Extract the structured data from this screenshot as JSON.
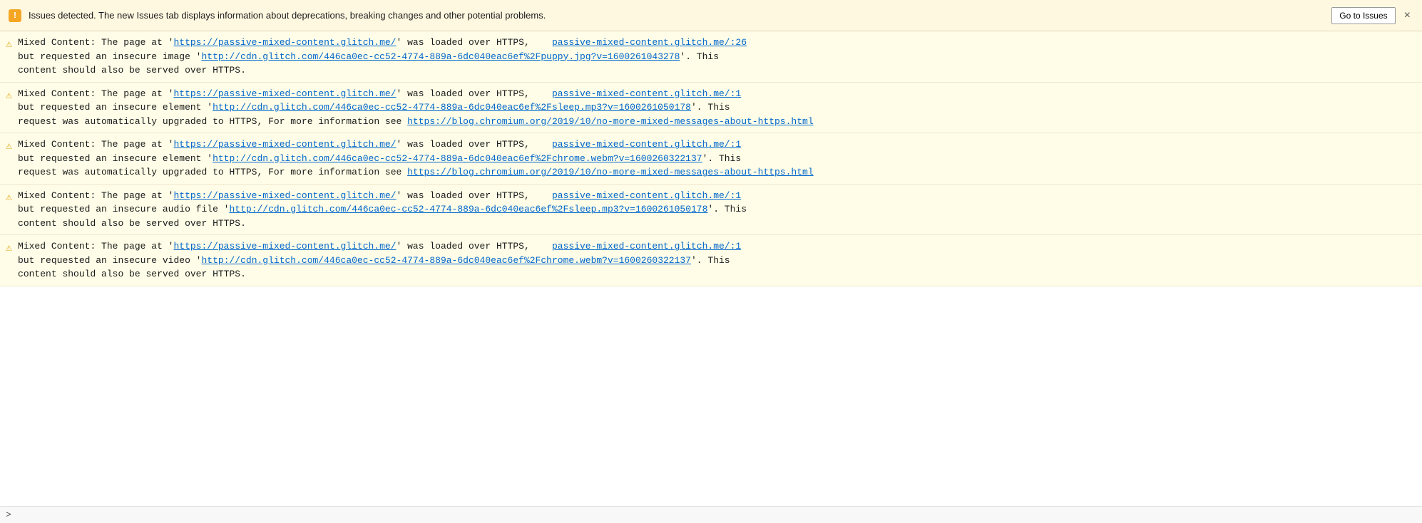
{
  "banner": {
    "icon": "!",
    "text": "Issues detected. The new Issues tab displays information about deprecations, breaking changes and other potential problems.",
    "go_to_issues_label": "Go to Issues",
    "close_label": "×"
  },
  "messages": [
    {
      "id": 1,
      "lines": [
        {
          "type": "mixed",
          "parts": [
            {
              "text": "Mixed Content: The page at '",
              "link": false
            },
            {
              "text": "https://passive-mixed-content.glitch.me/",
              "link": true,
              "href": "https://passive-mixed-content.glitch.me/"
            },
            {
              "text": "' was loaded over HTTPS,    ",
              "link": false
            },
            {
              "text": "passive-mixed-content.glitch.me/:26",
              "link": true,
              "href": "#"
            },
            {
              "text": "\nbut requested an insecure image '",
              "link": false
            },
            {
              "text": "http://cdn.glitch.com/446ca0ec-cc52-4774-889a-6dc040eac6ef%2Fpuppy.jpg?v=1600261043278",
              "link": true,
              "href": "#"
            },
            {
              "text": "'. This\ncontent should also be served over HTTPS.",
              "link": false
            }
          ]
        }
      ]
    },
    {
      "id": 2,
      "lines": [
        {
          "type": "mixed",
          "parts": [
            {
              "text": "Mixed Content: The page at '",
              "link": false
            },
            {
              "text": "https://passive-mixed-content.glitch.me/",
              "link": true,
              "href": "https://passive-mixed-content.glitch.me/"
            },
            {
              "text": "' was loaded over HTTPS,    ",
              "link": false
            },
            {
              "text": "passive-mixed-content.glitch.me/:1",
              "link": true,
              "href": "#"
            },
            {
              "text": "\nbut requested an insecure element '",
              "link": false
            },
            {
              "text": "http://cdn.glitch.com/446ca0ec-cc52-4774-889a-6dc040eac6ef%2Fsleep.mp3?v=1600261050178",
              "link": true,
              "href": "#"
            },
            {
              "text": "'. This\nrequest was automatically upgraded to HTTPS, For more information see ",
              "link": false
            },
            {
              "text": "https://blog.chromium.org/2019/10/no-more-mixed-messages-about-https.html",
              "link": true,
              "href": "#"
            }
          ]
        }
      ]
    },
    {
      "id": 3,
      "lines": [
        {
          "type": "mixed",
          "parts": [
            {
              "text": "Mixed Content: The page at '",
              "link": false
            },
            {
              "text": "https://passive-mixed-content.glitch.me/",
              "link": true,
              "href": "https://passive-mixed-content.glitch.me/"
            },
            {
              "text": "' was loaded over HTTPS,    ",
              "link": false
            },
            {
              "text": "passive-mixed-content.glitch.me/:1",
              "link": true,
              "href": "#"
            },
            {
              "text": "\nbut requested an insecure element '",
              "link": false
            },
            {
              "text": "http://cdn.glitch.com/446ca0ec-cc52-4774-889a-6dc040eac6ef%2Fchrome.webm?v=1600260322137",
              "link": true,
              "href": "#"
            },
            {
              "text": "'. This\nrequest was automatically upgraded to HTTPS, For more information see ",
              "link": false
            },
            {
              "text": "https://blog.chromium.org/2019/10/no-more-mixed-messages-about-https.html",
              "link": true,
              "href": "#"
            }
          ]
        }
      ]
    },
    {
      "id": 4,
      "lines": [
        {
          "type": "mixed",
          "parts": [
            {
              "text": "Mixed Content: The page at '",
              "link": false
            },
            {
              "text": "https://passive-mixed-content.glitch.me/",
              "link": true,
              "href": "https://passive-mixed-content.glitch.me/"
            },
            {
              "text": "' was loaded over HTTPS,    ",
              "link": false
            },
            {
              "text": "passive-mixed-content.glitch.me/:1",
              "link": true,
              "href": "#"
            },
            {
              "text": "\nbut requested an insecure audio file '",
              "link": false
            },
            {
              "text": "http://cdn.glitch.com/446ca0ec-cc52-4774-889a-6dc040eac6ef%2Fsleep.mp3?v=1600261050178",
              "link": true,
              "href": "#"
            },
            {
              "text": "'. This\ncontent should also be served over HTTPS.",
              "link": false
            }
          ]
        }
      ]
    },
    {
      "id": 5,
      "lines": [
        {
          "type": "mixed",
          "parts": [
            {
              "text": "Mixed Content: The page at '",
              "link": false
            },
            {
              "text": "https://passive-mixed-content.glitch.me/",
              "link": true,
              "href": "https://passive-mixed-content.glitch.me/"
            },
            {
              "text": "' was loaded over HTTPS,    ",
              "link": false
            },
            {
              "text": "passive-mixed-content.glitch.me/:1",
              "link": true,
              "href": "#"
            },
            {
              "text": "\nbut requested an insecure video '",
              "link": false
            },
            {
              "text": "http://cdn.glitch.com/446ca0ec-cc52-4774-889a-6dc040eac6ef%2Fchrome.webm?v=1600260322137",
              "link": true,
              "href": "#"
            },
            {
              "text": "'. This\ncontent should also be served over HTTPS.",
              "link": false
            }
          ]
        }
      ]
    }
  ],
  "bottom": {
    "prompt": ">"
  }
}
